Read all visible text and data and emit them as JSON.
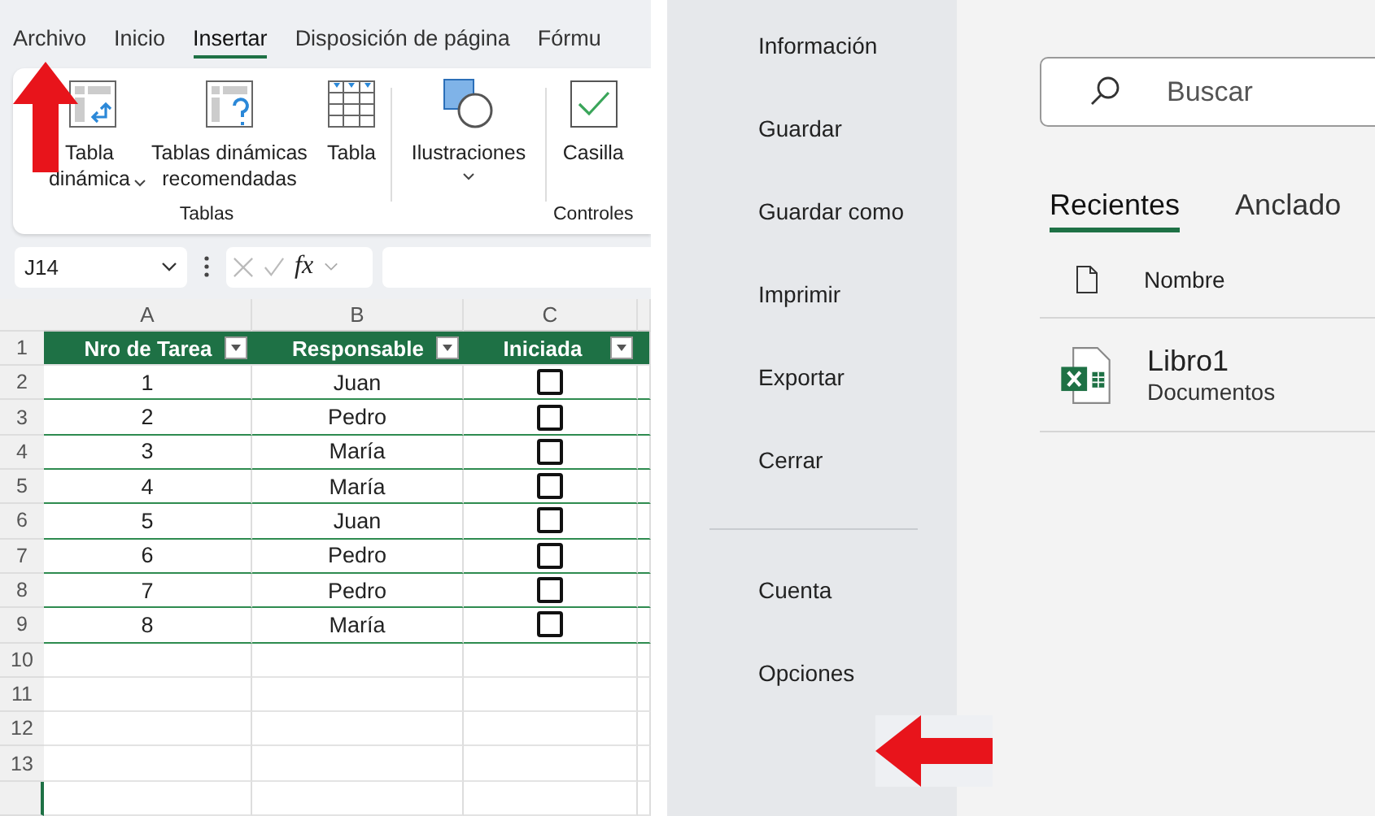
{
  "ribbon_tabs": [
    {
      "label": "Archivo",
      "selected": false
    },
    {
      "label": "Inicio",
      "selected": false
    },
    {
      "label": "Insertar",
      "selected": true
    },
    {
      "label": "Disposición de página",
      "selected": false
    },
    {
      "label": "Fórmu",
      "selected": false
    }
  ],
  "ribbon_groups": [
    {
      "label": "Tablas",
      "commands": [
        {
          "label": "Tabla dinámica",
          "kind": "pivot",
          "dropdown": true
        },
        {
          "label": "Tablas dinámicas recomendadas",
          "kind": "recommended",
          "dropdown": false
        },
        {
          "label": "Tabla",
          "kind": "table",
          "dropdown": false
        }
      ]
    },
    {
      "commands": [
        {
          "label": "Ilustraciones",
          "kind": "shapes",
          "dropdown": true
        }
      ]
    },
    {
      "label": "Controles",
      "commands": [
        {
          "label": "Casilla",
          "kind": "checkbox",
          "dropdown": false
        }
      ]
    }
  ],
  "formula_bar": {
    "name_box": "J14",
    "function_label": "fx"
  },
  "sheet": {
    "columns": [
      "A",
      "B",
      "C"
    ],
    "header_row": "1",
    "table_headers": [
      "Nro de Tarea",
      "Responsable",
      "Iniciada"
    ],
    "rows": [
      {
        "row": "2",
        "task": "1",
        "owner": "Juan",
        "checked": false
      },
      {
        "row": "3",
        "task": "2",
        "owner": "Pedro",
        "checked": false
      },
      {
        "row": "4",
        "task": "3",
        "owner": "María",
        "checked": false
      },
      {
        "row": "5",
        "task": "4",
        "owner": "María",
        "checked": false
      },
      {
        "row": "6",
        "task": "5",
        "owner": "Juan",
        "checked": false
      },
      {
        "row": "7",
        "task": "6",
        "owner": "Pedro",
        "checked": false
      },
      {
        "row": "8",
        "task": "7",
        "owner": "Pedro",
        "checked": false
      },
      {
        "row": "9",
        "task": "8",
        "owner": "María",
        "checked": false
      }
    ],
    "empty_rows": [
      "10",
      "11",
      "12",
      "13"
    ]
  },
  "backstage": {
    "menu_top": [
      "Información",
      "Guardar",
      "Guardar como",
      "Imprimir",
      "Exportar",
      "Cerrar"
    ],
    "menu_bottom": [
      "Cuenta",
      "Opciones"
    ],
    "search": {
      "placeholder": "Buscar"
    },
    "tabs": [
      {
        "label": "Recientes",
        "selected": true
      },
      {
        "label": "Anclado",
        "selected": false
      }
    ],
    "list_header": "Nombre",
    "files": [
      {
        "name": "Libro1",
        "location": "Documentos"
      }
    ]
  },
  "annotations": [
    {
      "kind": "up"
    },
    {
      "kind": "left"
    }
  ]
}
